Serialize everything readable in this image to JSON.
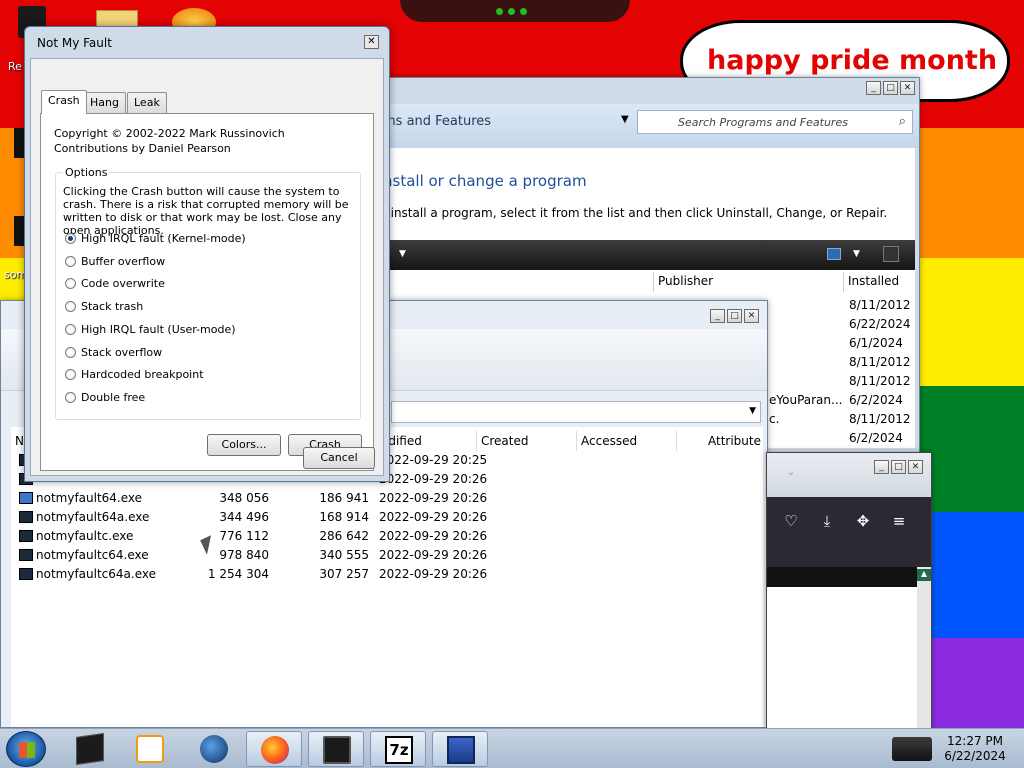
{
  "desktop": {
    "banner_text": "happy pride month",
    "icon_label_1": "Re",
    "icon_label_2": "som",
    "colors": {
      "red": "#e40303",
      "orange": "#ff8c00",
      "yellow": "#ffed00",
      "green": "#008026",
      "blue": "#0055ff",
      "violet": "#8a2be2"
    }
  },
  "programs_window": {
    "title_partial": "ms and Features",
    "search_placeholder": "Search Programs and Features",
    "heading_partial": "nstall or change a program",
    "subtext_partial": "ninstall a program, select it from the list and then click Uninstall, Change, or Repair.",
    "columns": {
      "publisher": "Publisher",
      "installed": "Installed"
    },
    "installed_dates": [
      "8/11/2012",
      "6/22/2024",
      "6/1/2024",
      "8/11/2012",
      "8/11/2012",
      "6/2/2024",
      "8/11/2012",
      "6/2/2024"
    ],
    "partial_publisher_1": "eYouParan...",
    "partial_publisher_2": "c."
  },
  "file_manager": {
    "columns": {
      "name": "N",
      "modified": "odified",
      "created": "Created",
      "accessed": "Accessed",
      "attributes": "Attribute"
    },
    "files": [
      {
        "name": "",
        "size": "",
        "packed": "",
        "modified": "2022-09-29 20:25",
        "icon": "exe-dark"
      },
      {
        "name": "",
        "size": "",
        "packed": "",
        "modified": "2022-09-29 20:26",
        "icon": "exe-dark"
      },
      {
        "name": "notmyfault64.exe",
        "size": "348 056",
        "packed": "186 941",
        "modified": "2022-09-29 20:26",
        "icon": "exe-blue"
      },
      {
        "name": "notmyfault64a.exe",
        "size": "344 496",
        "packed": "168 914",
        "modified": "2022-09-29 20:26",
        "icon": "exe-dark"
      },
      {
        "name": "notmyfaultc.exe",
        "size": "776 112",
        "packed": "286 642",
        "modified": "2022-09-29 20:26",
        "icon": "exe-dark"
      },
      {
        "name": "notmyfaultc64.exe",
        "size": "978 840",
        "packed": "340 555",
        "modified": "2022-09-29 20:26",
        "icon": "exe-dark"
      },
      {
        "name": "notmyfaultc64a.exe",
        "size": "1 254 304",
        "packed": "307 257",
        "modified": "2022-09-29 20:26",
        "icon": "exe-dark"
      }
    ]
  },
  "firefox_window": {
    "icons": [
      "pocket-icon",
      "download-icon",
      "extensions-icon",
      "menu-icon"
    ]
  },
  "dialog": {
    "title": "Not My Fault",
    "close_glyph": "✕",
    "tabs": [
      "Crash",
      "Hang",
      "Leak"
    ],
    "active_tab": "Crash",
    "copyright": "Copyright © 2002-2022 Mark Russinovich",
    "contributions": "Contributions by Daniel Pearson",
    "options_legend": "Options",
    "warning": "Clicking the Crash button will cause the system to crash. There is a risk that corrupted memory will be written to disk or that work may be lost. Close any open applications.",
    "options": [
      {
        "label": "High IRQL fault (Kernel-mode)",
        "selected": true
      },
      {
        "label": "Buffer overflow",
        "selected": false
      },
      {
        "label": "Code overwrite",
        "selected": false
      },
      {
        "label": "Stack trash",
        "selected": false
      },
      {
        "label": "High IRQL fault (User-mode)",
        "selected": false
      },
      {
        "label": "Stack overflow",
        "selected": false
      },
      {
        "label": "Hardcoded breakpoint",
        "selected": false
      },
      {
        "label": "Double free",
        "selected": false
      }
    ],
    "colors_button": "Colors...",
    "crash_button": "Crash",
    "cancel_button": "Cancel"
  },
  "taskbar": {
    "items": [
      "terminal-icon",
      "media-player-icon",
      "globe-icon",
      "firefox-icon",
      "monitor-icon",
      "7zip-icon",
      "notmyfault-icon"
    ],
    "seven_zip_label": "7z",
    "time": "12:27 PM",
    "date": "6/22/2024"
  }
}
